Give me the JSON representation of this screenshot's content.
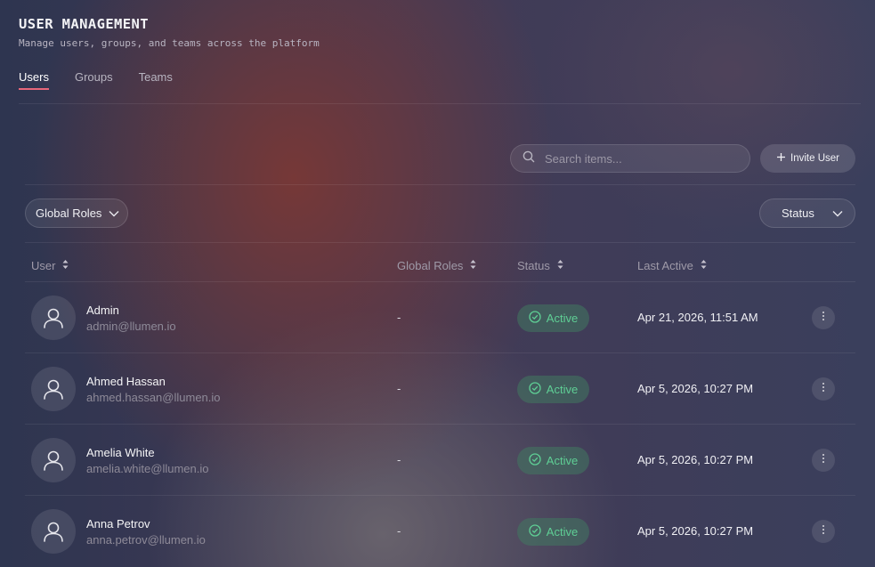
{
  "header": {
    "title": "USER MANAGEMENT",
    "subtitle": "Manage users, groups, and teams across the platform"
  },
  "tabs": [
    {
      "label": "Users",
      "active": true
    },
    {
      "label": "Groups",
      "active": false
    },
    {
      "label": "Teams",
      "active": false
    }
  ],
  "toolbar": {
    "search_placeholder": "Search items...",
    "invite_label": "Invite User",
    "roles_filter_label": "Global Roles",
    "status_filter_label": "Status"
  },
  "table": {
    "columns": [
      "User",
      "Global Roles",
      "Status",
      "Last Active"
    ],
    "rows": [
      {
        "name": "Admin",
        "email": "admin@llumen.io",
        "roles": "-",
        "status": "Active",
        "last_active": "Apr 21, 2026, 11:51 AM"
      },
      {
        "name": "Ahmed Hassan",
        "email": "ahmed.hassan@llumen.io",
        "roles": "-",
        "status": "Active",
        "last_active": "Apr 5, 2026, 10:27 PM"
      },
      {
        "name": "Amelia White",
        "email": "amelia.white@llumen.io",
        "roles": "-",
        "status": "Active",
        "last_active": "Apr 5, 2026, 10:27 PM"
      },
      {
        "name": "Anna Petrov",
        "email": "anna.petrov@llumen.io",
        "roles": "-",
        "status": "Active",
        "last_active": "Apr 5, 2026, 10:27 PM"
      }
    ]
  },
  "colors": {
    "tab_underline": "#e7667a",
    "status_active_text": "#5fcf95",
    "status_active_bg": "#3f6e5c"
  },
  "icons": {
    "search": "search-icon",
    "invite": "plus-icon",
    "dropdown": "chevron-down-icon",
    "sort": "sort-icon",
    "avatar": "user-avatar-icon",
    "status": "check-circle-icon",
    "row_menu": "more-vertical-icon"
  }
}
